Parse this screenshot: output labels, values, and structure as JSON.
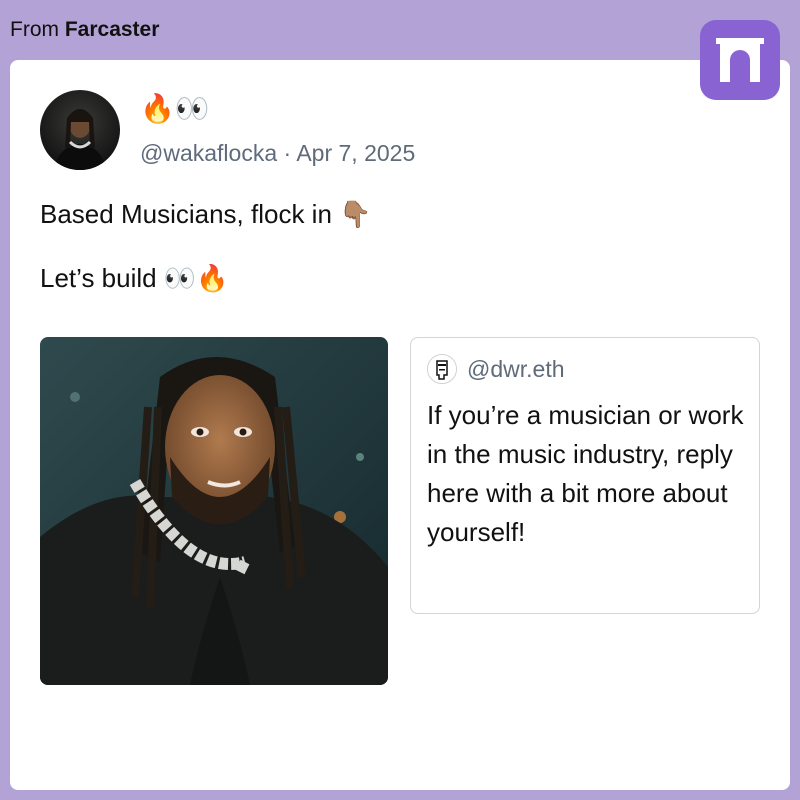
{
  "source": {
    "prefix": "From",
    "platform": "Farcaster"
  },
  "logo": {
    "icon": "farcaster-arch-icon",
    "color": "#8a63d2"
  },
  "post": {
    "display_name": "🔥👀",
    "handle": "@wakaflocka",
    "separator": "·",
    "date": "Apr 7, 2025",
    "text": "Based Musicians, flock in 👇🏽\n\nLet’s build 👀🔥"
  },
  "quote": {
    "handle": "@dwr.eth",
    "text": "If you’re a musician or work in the music industry, reply here with a bit more about yourself!"
  },
  "colors": {
    "frame": "#b3a2d6",
    "card": "#ffffff",
    "brand": "#8a63d2",
    "muted_text": "#5f6b7a"
  }
}
